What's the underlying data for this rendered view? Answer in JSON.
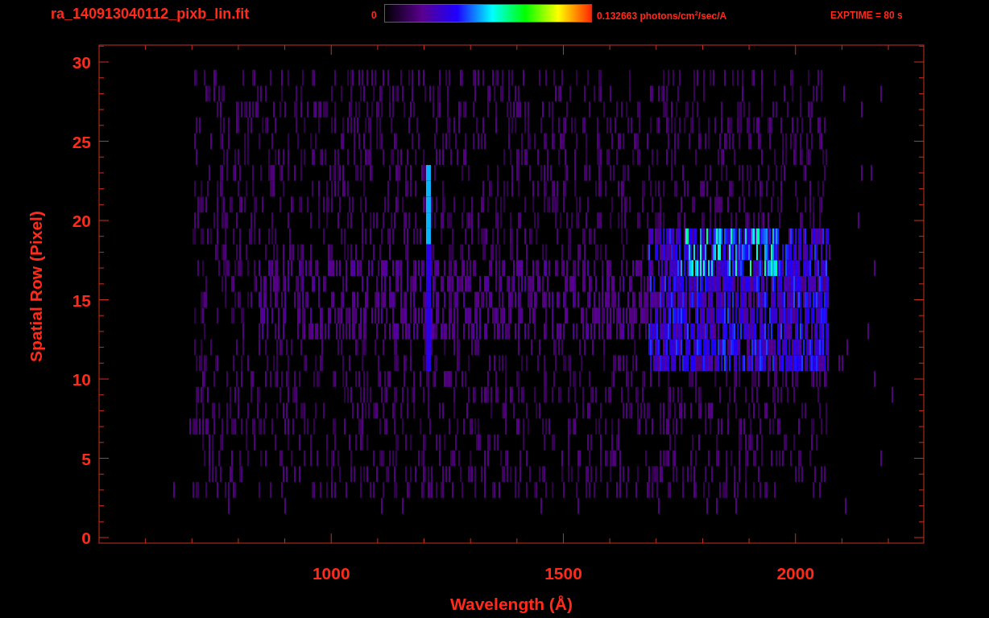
{
  "title": "ra_140913040112_pixb_lin.fit",
  "colorbar": {
    "min_label": "0",
    "max_label": "0.132663 photons/cm$^{2}$/sec/A"
  },
  "exposure": "EXPTIME = 80 s",
  "plot": {
    "ylabel": "Spatial Row (Pixel)",
    "xlabel": "Wavelength (Å)",
    "xticks": [
      "1000",
      "1500",
      "2000"
    ],
    "yticks": [
      "30",
      "25",
      "20",
      "15",
      "10",
      "5",
      "0"
    ]
  }
}
